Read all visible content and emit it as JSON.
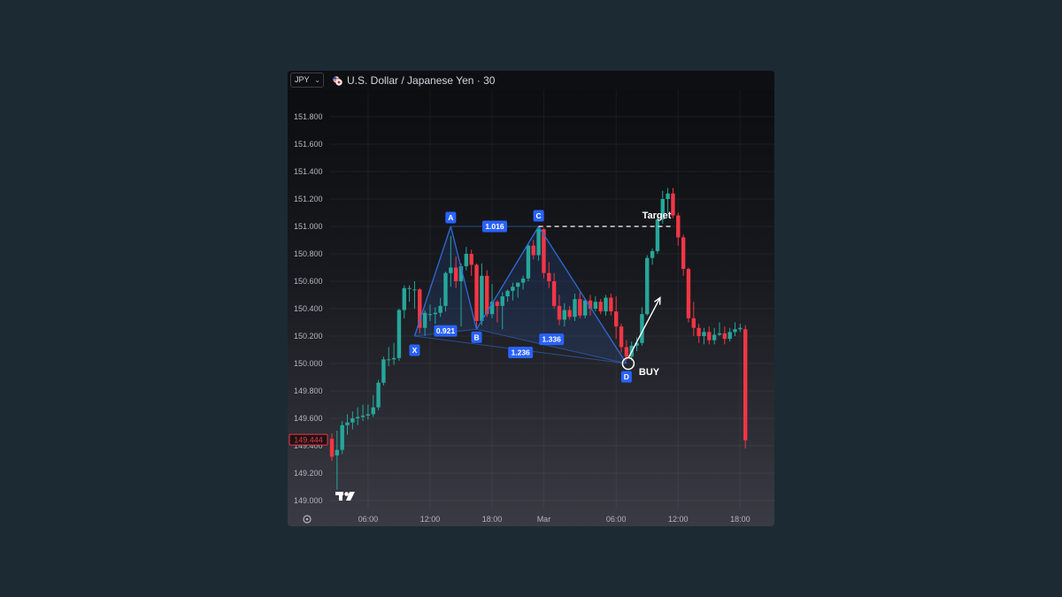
{
  "header": {
    "symbol_select": "JPY",
    "title": "U.S. Dollar / Japanese Yen · 30"
  },
  "colors": {
    "up": "#26a69a",
    "down": "#f23645",
    "pattern": "#2f6bd6",
    "label_bg": "#2962ff"
  },
  "icons": {
    "symbol_dropdown": "chevron-down-icon",
    "pair_flag": "currency-flag-icon",
    "logo": "tradingview-logo-icon",
    "settings": "settings-icon"
  },
  "chart_data": {
    "type": "candlestick",
    "title": "U.S. Dollar / Japanese Yen · 30",
    "ylim": [
      148.96,
      151.98
    ],
    "y_ticks": [
      "151.800",
      "151.600",
      "151.400",
      "151.200",
      "151.000",
      "150.800",
      "150.600",
      "150.400",
      "150.200",
      "150.000",
      "149.800",
      "149.600",
      "149.400",
      "149.200",
      "149.000"
    ],
    "x_ticks": [
      {
        "label": "06:00",
        "bar": 7
      },
      {
        "label": "12:00",
        "bar": 19
      },
      {
        "label": "18:00",
        "bar": 31
      },
      {
        "label": "Mar",
        "bar": 41
      },
      {
        "label": "06:00",
        "bar": 55
      },
      {
        "label": "12:00",
        "bar": 67
      },
      {
        "label": "18:00",
        "bar": 79
      }
    ],
    "last_price": "149.444",
    "grid": true,
    "candles": [
      [
        149.45,
        149.49,
        149.29,
        149.32
      ],
      [
        149.33,
        149.51,
        149.08,
        149.37
      ],
      [
        149.37,
        149.58,
        149.34,
        149.55
      ],
      [
        149.55,
        149.63,
        149.48,
        149.57
      ],
      [
        149.57,
        149.65,
        149.52,
        149.6
      ],
      [
        149.6,
        149.68,
        149.55,
        149.61
      ],
      [
        149.61,
        149.7,
        149.58,
        149.62
      ],
      [
        149.62,
        149.7,
        149.59,
        149.63
      ],
      [
        149.63,
        149.77,
        149.61,
        149.68
      ],
      [
        149.68,
        149.88,
        149.66,
        149.86
      ],
      [
        149.86,
        150.05,
        149.84,
        150.03
      ],
      [
        150.03,
        150.12,
        149.98,
        150.03
      ],
      [
        150.03,
        150.15,
        149.99,
        150.04
      ],
      [
        150.04,
        150.4,
        150.02,
        150.39
      ],
      [
        150.39,
        150.57,
        150.33,
        150.55
      ],
      [
        150.55,
        150.57,
        150.45,
        150.55
      ],
      [
        150.54,
        150.6,
        150.4,
        150.54
      ],
      [
        150.54,
        150.55,
        150.22,
        150.26
      ],
      [
        150.26,
        150.39,
        150.2,
        150.37
      ],
      [
        150.36,
        150.43,
        150.31,
        150.36
      ],
      [
        150.36,
        150.41,
        150.29,
        150.37
      ],
      [
        150.37,
        150.48,
        150.34,
        150.42
      ],
      [
        150.42,
        150.67,
        150.38,
        150.66
      ],
      [
        150.66,
        150.93,
        150.56,
        150.7
      ],
      [
        150.7,
        150.78,
        150.55,
        150.6
      ],
      [
        150.6,
        150.73,
        150.27,
        150.71
      ],
      [
        150.71,
        150.85,
        150.68,
        150.8
      ],
      [
        150.8,
        150.83,
        150.64,
        150.72
      ],
      [
        150.72,
        150.73,
        150.25,
        150.31
      ],
      [
        150.31,
        150.73,
        150.28,
        150.64
      ],
      [
        150.64,
        150.68,
        150.34,
        150.36
      ],
      [
        150.36,
        150.58,
        150.33,
        150.45
      ],
      [
        150.45,
        150.46,
        150.3,
        150.42
      ],
      [
        150.42,
        150.52,
        150.25,
        150.49
      ],
      [
        150.49,
        150.54,
        150.45,
        150.53
      ],
      [
        150.53,
        150.59,
        150.46,
        150.56
      ],
      [
        150.56,
        150.59,
        150.48,
        150.59
      ],
      [
        150.59,
        150.64,
        150.54,
        150.62
      ],
      [
        150.62,
        150.88,
        150.6,
        150.86
      ],
      [
        150.86,
        150.9,
        150.76,
        150.79
      ],
      [
        150.79,
        151.0,
        150.75,
        150.98
      ],
      [
        150.98,
        150.99,
        150.62,
        150.66
      ],
      [
        150.66,
        150.74,
        150.55,
        150.6
      ],
      [
        150.6,
        150.66,
        150.4,
        150.42
      ],
      [
        150.42,
        150.5,
        150.28,
        150.32
      ],
      [
        150.32,
        150.44,
        150.27,
        150.39
      ],
      [
        150.39,
        150.42,
        150.32,
        150.34
      ],
      [
        150.34,
        150.51,
        150.31,
        150.47
      ],
      [
        150.47,
        150.52,
        150.33,
        150.35
      ],
      [
        150.35,
        150.47,
        150.33,
        150.46
      ],
      [
        150.46,
        150.5,
        150.35,
        150.4
      ],
      [
        150.4,
        150.49,
        150.38,
        150.45
      ],
      [
        150.45,
        150.47,
        150.36,
        150.38
      ],
      [
        150.38,
        150.5,
        150.35,
        150.48
      ],
      [
        150.48,
        150.51,
        150.35,
        150.38
      ],
      [
        150.38,
        150.49,
        150.18,
        150.27
      ],
      [
        150.27,
        150.29,
        150.08,
        150.12
      ],
      [
        150.12,
        150.17,
        150.02,
        150.05
      ],
      [
        150.05,
        150.16,
        150.02,
        150.13
      ],
      [
        150.13,
        150.19,
        150.09,
        150.15
      ],
      [
        150.15,
        150.41,
        150.13,
        150.36
      ],
      [
        150.36,
        150.79,
        150.35,
        150.77
      ],
      [
        150.77,
        150.84,
        150.72,
        150.82
      ],
      [
        150.82,
        151.07,
        150.8,
        151.05
      ],
      [
        151.05,
        151.26,
        151.02,
        151.2
      ],
      [
        151.2,
        151.28,
        151.1,
        151.24
      ],
      [
        151.24,
        151.28,
        151.06,
        151.08
      ],
      [
        151.08,
        151.1,
        150.86,
        150.92
      ],
      [
        150.92,
        150.94,
        150.64,
        150.69
      ],
      [
        150.69,
        150.7,
        150.3,
        150.33
      ],
      [
        150.33,
        150.45,
        150.2,
        150.26
      ],
      [
        150.26,
        150.29,
        150.15,
        150.2
      ],
      [
        150.2,
        150.26,
        150.14,
        150.23
      ],
      [
        150.23,
        150.27,
        150.14,
        150.17
      ],
      [
        150.17,
        150.26,
        150.14,
        150.21
      ],
      [
        150.21,
        150.3,
        150.2,
        150.22
      ],
      [
        150.22,
        150.27,
        150.14,
        150.18
      ],
      [
        150.18,
        150.26,
        150.16,
        150.23
      ],
      [
        150.23,
        150.3,
        150.2,
        150.25
      ],
      [
        150.25,
        150.29,
        150.23,
        150.26
      ],
      [
        150.25,
        150.28,
        149.38,
        149.44
      ]
    ],
    "harmonic_pattern": {
      "points": [
        {
          "label": "X",
          "bar": 16,
          "price": 150.2
        },
        {
          "label": "A",
          "bar": 23,
          "price": 151.0
        },
        {
          "label": "B",
          "bar": 28,
          "price": 150.25
        },
        {
          "label": "C",
          "bar": 40,
          "price": 151.0
        },
        {
          "label": "D",
          "bar": 57,
          "price": 150.0
        }
      ],
      "ratios": [
        "0.921",
        "1.016",
        "1.236",
        "1.336"
      ]
    },
    "annotations": {
      "target": "Target",
      "buy": "BUY"
    }
  }
}
